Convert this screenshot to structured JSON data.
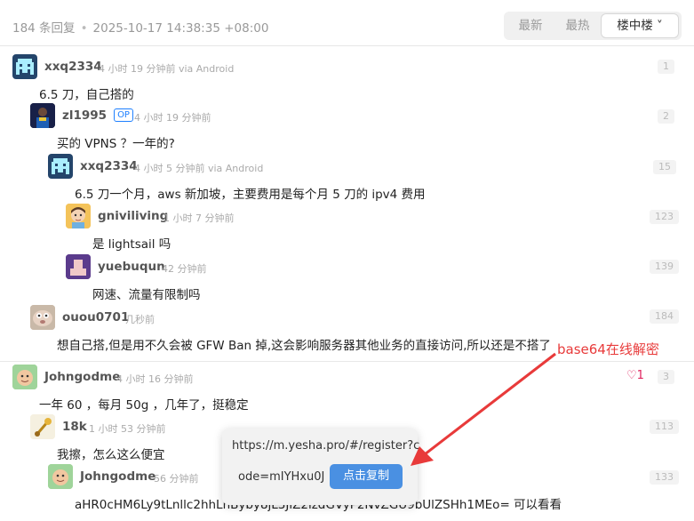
{
  "header": {
    "reply_count": "184 条回复",
    "separator": "•",
    "timestamp": "2025-10-17 14:38:35 +08:00",
    "sort_newest": "最新",
    "sort_hot": "最热",
    "sort_floor": "楼中楼 ˅"
  },
  "comments": [
    {
      "user": "xxq2334",
      "meta": "4 小时 19 分钟前 via Android",
      "text": "6.5 刀，自己搭的",
      "floor": "1"
    },
    {
      "user": "zl1995",
      "op": "OP",
      "meta": "4 小时 19 分钟前",
      "text": "买的 VPNS ？一年的?",
      "floor": "2"
    },
    {
      "user": "xxq2334",
      "meta": "4 小时 5 分钟前 via Android",
      "text": "6.5 刀一个月，aws 新加坡，主要费用是每个月 5 刀的 ipv4 费用",
      "floor": "15"
    },
    {
      "user": "gniviliving",
      "meta": "1 小时 7 分钟前",
      "text": "是 lightsail 吗",
      "floor": "123"
    },
    {
      "user": "yuebuqun",
      "meta": "42 分钟前",
      "text": "网速、流量有限制吗",
      "floor": "139"
    },
    {
      "user": "ouou0701",
      "meta": "几秒前",
      "text": "想自己搭,但是用不久会被 GFW Ban 掉,这会影响服务器其他业务的直接访问,所以还是不搭了",
      "floor": "184"
    },
    {
      "user": "Johngodme",
      "meta": "4 小时 16 分钟前",
      "text": "一年 60 ，每月 50g ，几年了，挺稳定",
      "floor": "3",
      "likes": "♡1"
    },
    {
      "user": "18k",
      "meta": "1 小时 53 分钟前",
      "text": "我擦，怎么这么便宜",
      "floor": "113"
    },
    {
      "user": "Johngodme",
      "meta": "56 分钟前",
      "text": "aHR0cHM6Ly9tLnllc2hhLnByby8jL3JlZ2lzdGVyP2NvZGU9bUlZSHh1MEo= 可以看看",
      "floor": "133"
    }
  ],
  "popup": {
    "line1": "https://m.yesha.pro/#/register?c",
    "line2": "ode=mIYHxu0J",
    "copy_button": "点击复制"
  },
  "annotation": "base64在线解密",
  "colors": {
    "accent": "#4a90e2",
    "annotation": "#e83a3a",
    "op_badge": "#1e80ff"
  }
}
